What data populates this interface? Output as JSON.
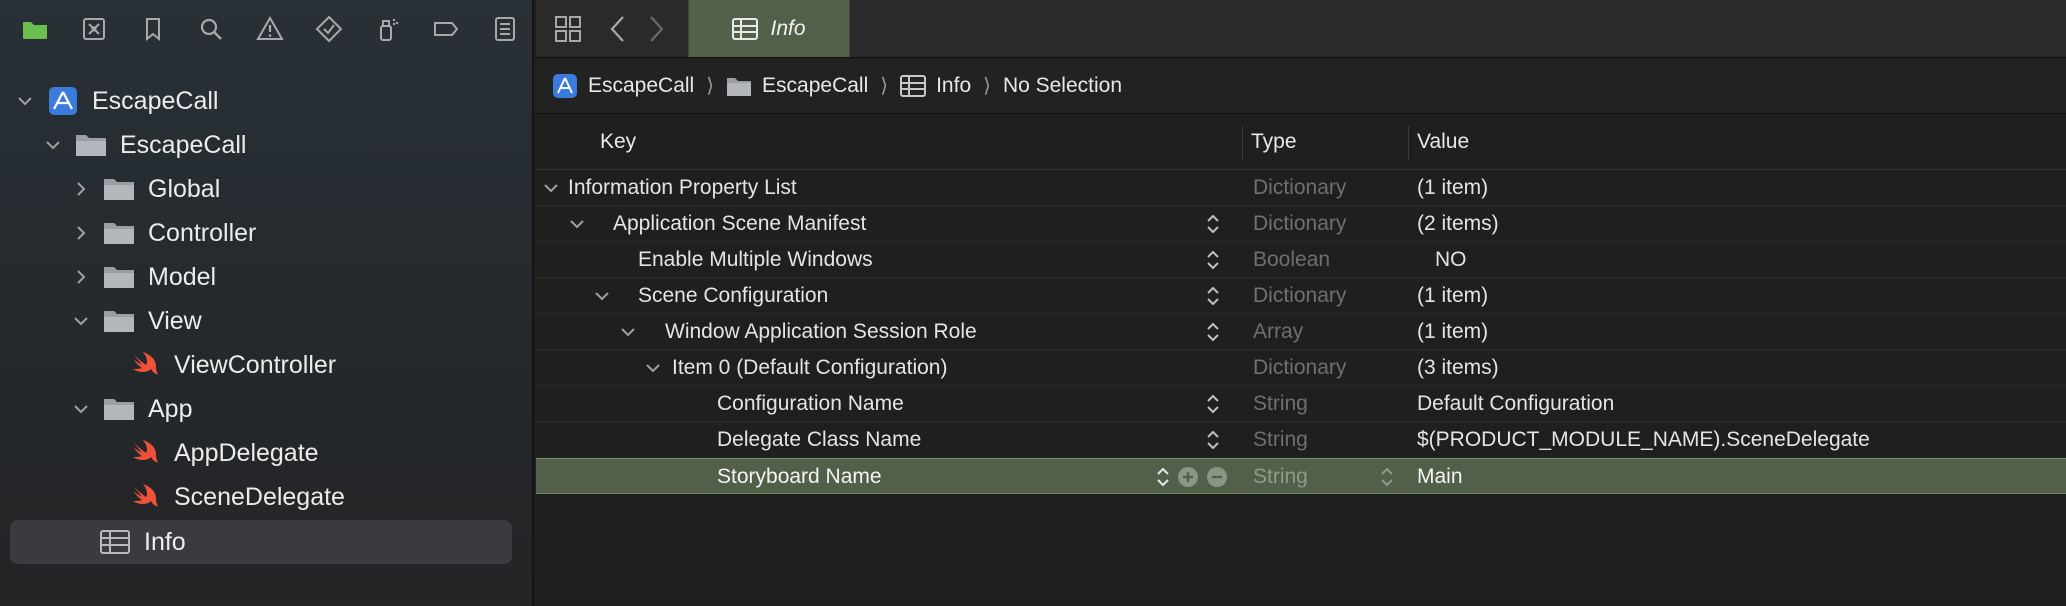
{
  "navigator": {
    "toolbar_icons": [
      "folder-icon",
      "source-control-icon",
      "bookmark-icon",
      "search-icon",
      "warning-icon",
      "test-icon",
      "debug-icon",
      "breakpoint-icon",
      "report-icon"
    ],
    "tree": [
      {
        "label": "EscapeCall",
        "type": "project",
        "expanded": true,
        "level": 0
      },
      {
        "label": "EscapeCall",
        "type": "folder",
        "expanded": true,
        "level": 1
      },
      {
        "label": "Global",
        "type": "folder",
        "expanded": false,
        "level": 2
      },
      {
        "label": "Controller",
        "type": "folder",
        "expanded": false,
        "level": 2
      },
      {
        "label": "Model",
        "type": "folder",
        "expanded": false,
        "level": 2
      },
      {
        "label": "View",
        "type": "folder",
        "expanded": true,
        "level": 2
      },
      {
        "label": "ViewController",
        "type": "swift",
        "level": 3
      },
      {
        "label": "App",
        "type": "folder",
        "expanded": true,
        "level": 2
      },
      {
        "label": "AppDelegate",
        "type": "swift",
        "level": 3
      },
      {
        "label": "SceneDelegate",
        "type": "swift",
        "level": 3
      },
      {
        "label": "Info",
        "type": "plist",
        "level": 2,
        "selected": true
      }
    ]
  },
  "editor": {
    "tab_label": "Info",
    "breadcrumb": [
      "EscapeCall",
      "EscapeCall",
      "Info",
      "No Selection"
    ],
    "columns": {
      "key": "Key",
      "type": "Type",
      "value": "Value"
    },
    "rows": [
      {
        "key": "Information Property List",
        "type": "Dictionary",
        "value": "(1 item)"
      },
      {
        "key": "Application Scene Manifest",
        "type": "Dictionary",
        "value": "(2 items)"
      },
      {
        "key": "Enable Multiple Windows",
        "type": "Boolean",
        "value": "NO"
      },
      {
        "key": "Scene Configuration",
        "type": "Dictionary",
        "value": "(1 item)"
      },
      {
        "key": "Window Application Session Role",
        "type": "Array",
        "value": "(1 item)"
      },
      {
        "key": "Item 0 (Default Configuration)",
        "type": "Dictionary",
        "value": "(3 items)"
      },
      {
        "key": "Configuration Name",
        "type": "String",
        "value": "Default Configuration"
      },
      {
        "key": "Delegate Class Name",
        "type": "String",
        "value": "$(PRODUCT_MODULE_NAME).SceneDelegate"
      },
      {
        "key": "Storyboard Name",
        "type": "String",
        "value": "Main",
        "selected": true
      }
    ]
  },
  "colors": {
    "accent_green": "#52604a",
    "folder_gray": "#9b9ea3",
    "swift_orange": "#f05138",
    "project_blue": "#3b82f6"
  }
}
